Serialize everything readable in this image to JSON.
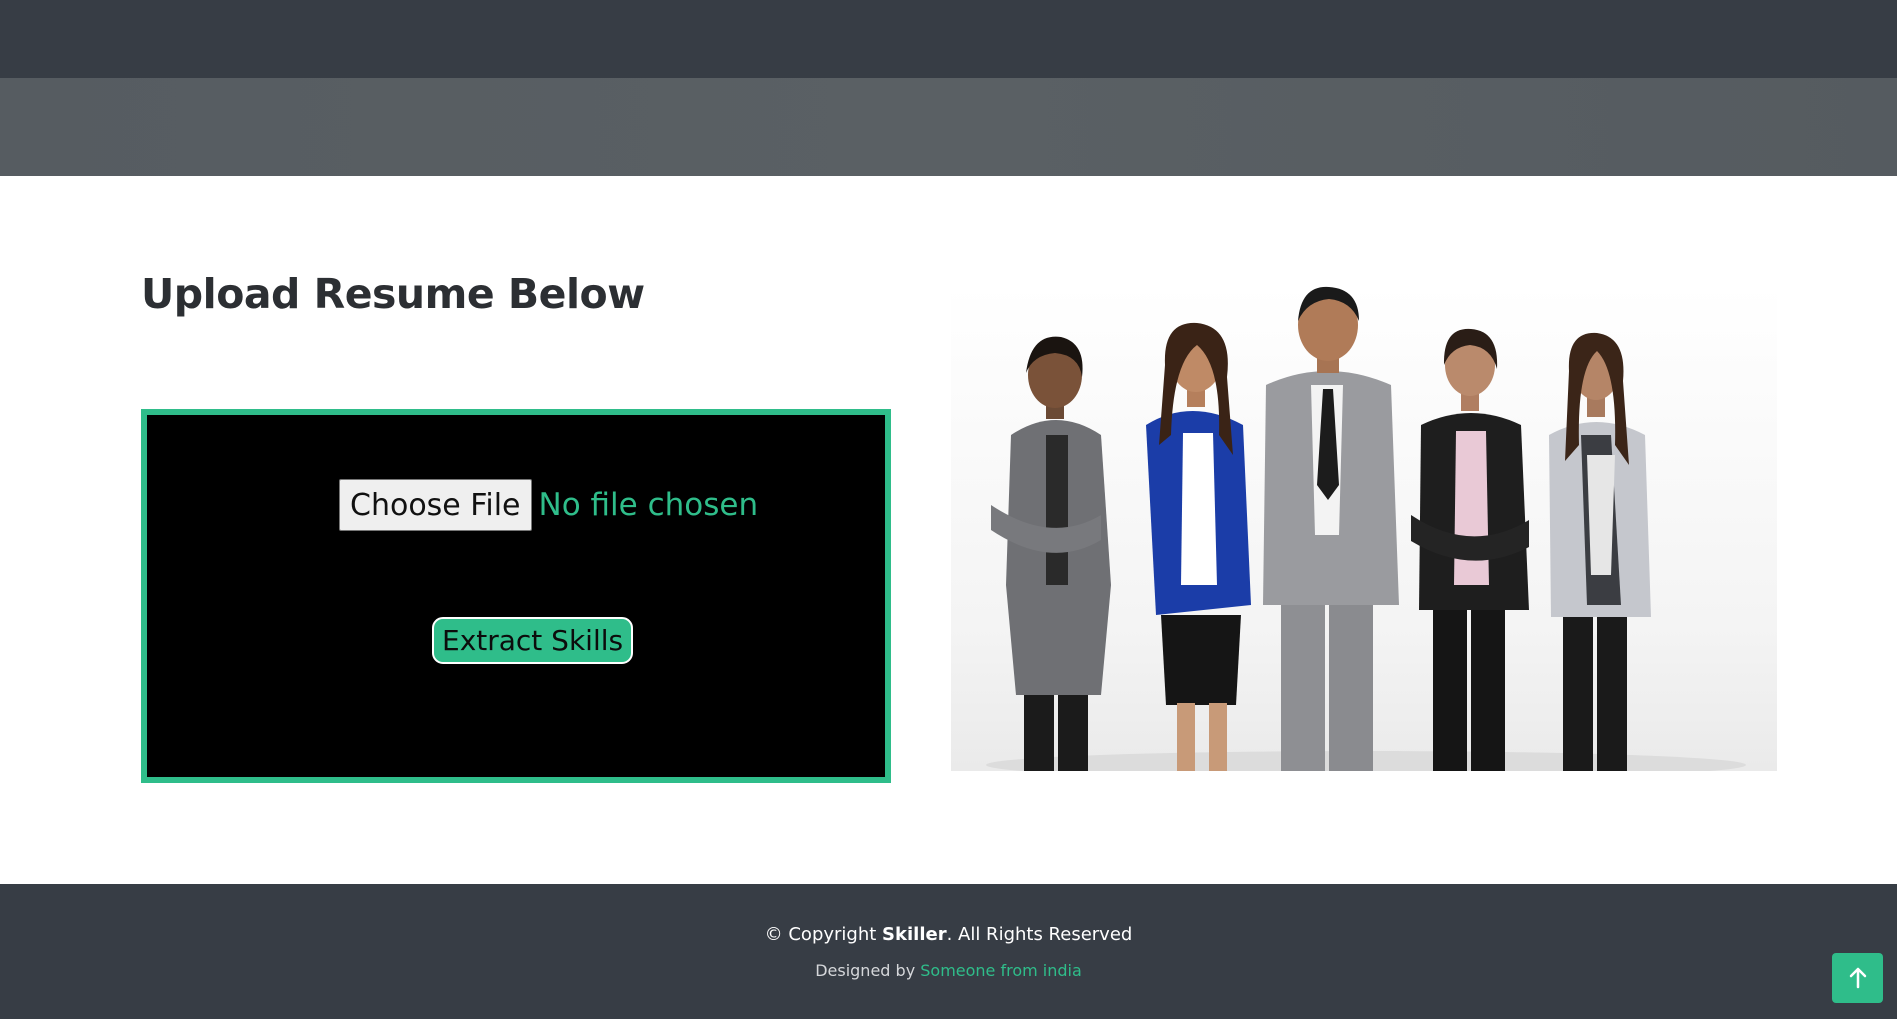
{
  "header": {
    "topbar_color": "#373d45",
    "banner_color": "#585e63"
  },
  "main": {
    "title": "Upload Resume Below",
    "upload": {
      "choose_file_label": "Choose File",
      "file_status": "No file chosen",
      "submit_label": "Extract Skills"
    },
    "image": {
      "subject": "group of five business professionals standing"
    }
  },
  "footer": {
    "copyright_prefix": "© Copyright ",
    "brand": "Skiller",
    "copyright_suffix": ". All Rights Reserved",
    "designed_prefix": "Designed by ",
    "designer_link": "Someone from india"
  },
  "back_to_top": {
    "icon": "arrow-up-icon"
  },
  "colors": {
    "accent": "#2fbd8a",
    "dark": "#373d45",
    "upload_background": "#000000"
  }
}
